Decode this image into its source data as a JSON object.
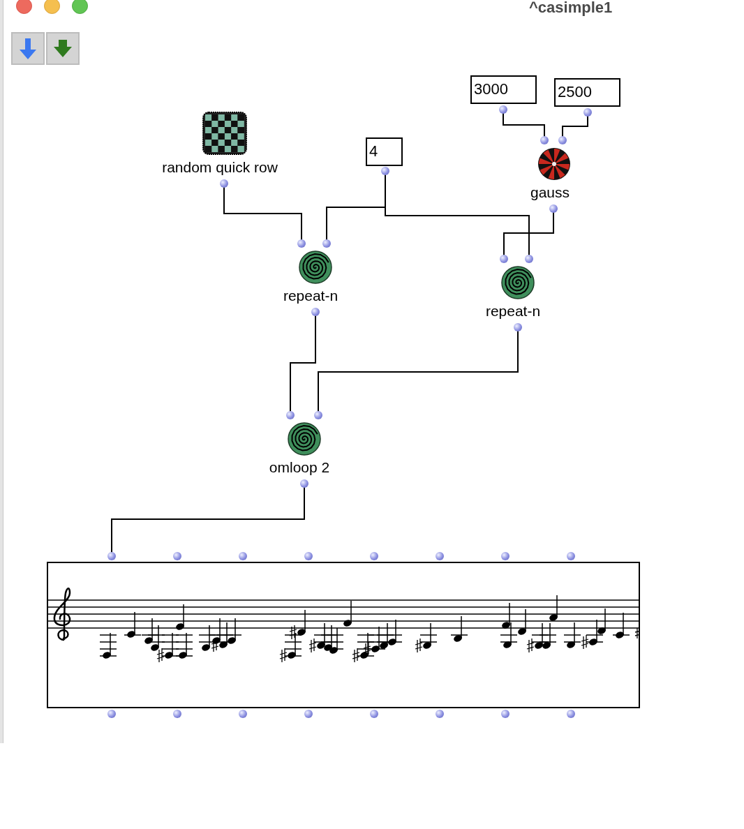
{
  "window": {
    "title": "^casimple1"
  },
  "nodes": [
    {
      "kind": "patch",
      "label": "random quick row"
    },
    {
      "kind": "number",
      "value": "4"
    },
    {
      "kind": "number",
      "value": "3000"
    },
    {
      "kind": "number",
      "value": "2500"
    },
    {
      "kind": "random",
      "label": "gauss"
    },
    {
      "kind": "loop",
      "label": "repeat-n"
    },
    {
      "kind": "loop",
      "label": "repeat-n"
    },
    {
      "kind": "loop",
      "label": "omloop 2"
    },
    {
      "kind": "score"
    }
  ]
}
